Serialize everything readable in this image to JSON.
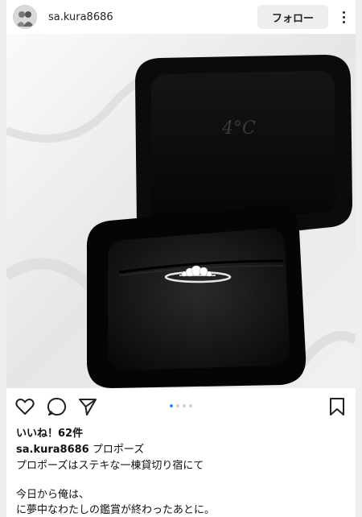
{
  "header": {
    "username": "sa.kura8686",
    "follow_label": "フォロー"
  },
  "photo": {
    "box_logo": "4°C"
  },
  "carousel": {
    "count": 4,
    "active_index": 0
  },
  "post": {
    "likes": "いいね！62件",
    "caption_user": "sa.kura8686",
    "caption_title": " プロポーズ ",
    "lines": [
      "プロポーズはステキな一棟貸切り宿にて",
      "今日から俺は、",
      "に夢中なわたしの鑑賞が終わったあとに。"
    ]
  }
}
